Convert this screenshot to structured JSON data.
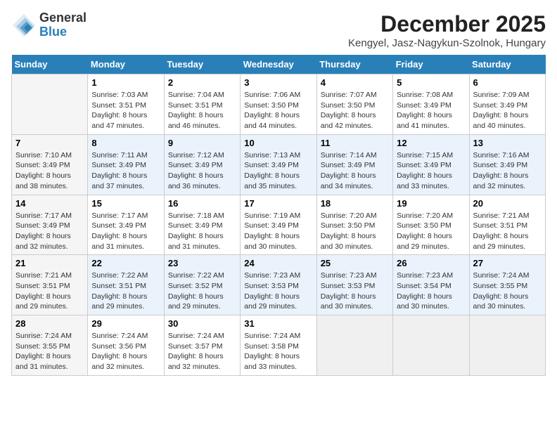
{
  "logo": {
    "general": "General",
    "blue": "Blue"
  },
  "title": "December 2025",
  "subtitle": "Kengyel, Jasz-Nagykun-Szolnok, Hungary",
  "days_header": [
    "Sunday",
    "Monday",
    "Tuesday",
    "Wednesday",
    "Thursday",
    "Friday",
    "Saturday"
  ],
  "weeks": [
    [
      {
        "day": "",
        "sunrise": "",
        "sunset": "",
        "daylight": ""
      },
      {
        "day": "1",
        "sunrise": "Sunrise: 7:03 AM",
        "sunset": "Sunset: 3:51 PM",
        "daylight": "Daylight: 8 hours and 47 minutes."
      },
      {
        "day": "2",
        "sunrise": "Sunrise: 7:04 AM",
        "sunset": "Sunset: 3:51 PM",
        "daylight": "Daylight: 8 hours and 46 minutes."
      },
      {
        "day": "3",
        "sunrise": "Sunrise: 7:06 AM",
        "sunset": "Sunset: 3:50 PM",
        "daylight": "Daylight: 8 hours and 44 minutes."
      },
      {
        "day": "4",
        "sunrise": "Sunrise: 7:07 AM",
        "sunset": "Sunset: 3:50 PM",
        "daylight": "Daylight: 8 hours and 42 minutes."
      },
      {
        "day": "5",
        "sunrise": "Sunrise: 7:08 AM",
        "sunset": "Sunset: 3:49 PM",
        "daylight": "Daylight: 8 hours and 41 minutes."
      },
      {
        "day": "6",
        "sunrise": "Sunrise: 7:09 AM",
        "sunset": "Sunset: 3:49 PM",
        "daylight": "Daylight: 8 hours and 40 minutes."
      }
    ],
    [
      {
        "day": "7",
        "sunrise": "Sunrise: 7:10 AM",
        "sunset": "Sunset: 3:49 PM",
        "daylight": "Daylight: 8 hours and 38 minutes."
      },
      {
        "day": "8",
        "sunrise": "Sunrise: 7:11 AM",
        "sunset": "Sunset: 3:49 PM",
        "daylight": "Daylight: 8 hours and 37 minutes."
      },
      {
        "day": "9",
        "sunrise": "Sunrise: 7:12 AM",
        "sunset": "Sunset: 3:49 PM",
        "daylight": "Daylight: 8 hours and 36 minutes."
      },
      {
        "day": "10",
        "sunrise": "Sunrise: 7:13 AM",
        "sunset": "Sunset: 3:49 PM",
        "daylight": "Daylight: 8 hours and 35 minutes."
      },
      {
        "day": "11",
        "sunrise": "Sunrise: 7:14 AM",
        "sunset": "Sunset: 3:49 PM",
        "daylight": "Daylight: 8 hours and 34 minutes."
      },
      {
        "day": "12",
        "sunrise": "Sunrise: 7:15 AM",
        "sunset": "Sunset: 3:49 PM",
        "daylight": "Daylight: 8 hours and 33 minutes."
      },
      {
        "day": "13",
        "sunrise": "Sunrise: 7:16 AM",
        "sunset": "Sunset: 3:49 PM",
        "daylight": "Daylight: 8 hours and 32 minutes."
      }
    ],
    [
      {
        "day": "14",
        "sunrise": "Sunrise: 7:17 AM",
        "sunset": "Sunset: 3:49 PM",
        "daylight": "Daylight: 8 hours and 32 minutes."
      },
      {
        "day": "15",
        "sunrise": "Sunrise: 7:17 AM",
        "sunset": "Sunset: 3:49 PM",
        "daylight": "Daylight: 8 hours and 31 minutes."
      },
      {
        "day": "16",
        "sunrise": "Sunrise: 7:18 AM",
        "sunset": "Sunset: 3:49 PM",
        "daylight": "Daylight: 8 hours and 31 minutes."
      },
      {
        "day": "17",
        "sunrise": "Sunrise: 7:19 AM",
        "sunset": "Sunset: 3:49 PM",
        "daylight": "Daylight: 8 hours and 30 minutes."
      },
      {
        "day": "18",
        "sunrise": "Sunrise: 7:20 AM",
        "sunset": "Sunset: 3:50 PM",
        "daylight": "Daylight: 8 hours and 30 minutes."
      },
      {
        "day": "19",
        "sunrise": "Sunrise: 7:20 AM",
        "sunset": "Sunset: 3:50 PM",
        "daylight": "Daylight: 8 hours and 29 minutes."
      },
      {
        "day": "20",
        "sunrise": "Sunrise: 7:21 AM",
        "sunset": "Sunset: 3:51 PM",
        "daylight": "Daylight: 8 hours and 29 minutes."
      }
    ],
    [
      {
        "day": "21",
        "sunrise": "Sunrise: 7:21 AM",
        "sunset": "Sunset: 3:51 PM",
        "daylight": "Daylight: 8 hours and 29 minutes."
      },
      {
        "day": "22",
        "sunrise": "Sunrise: 7:22 AM",
        "sunset": "Sunset: 3:51 PM",
        "daylight": "Daylight: 8 hours and 29 minutes."
      },
      {
        "day": "23",
        "sunrise": "Sunrise: 7:22 AM",
        "sunset": "Sunset: 3:52 PM",
        "daylight": "Daylight: 8 hours and 29 minutes."
      },
      {
        "day": "24",
        "sunrise": "Sunrise: 7:23 AM",
        "sunset": "Sunset: 3:53 PM",
        "daylight": "Daylight: 8 hours and 29 minutes."
      },
      {
        "day": "25",
        "sunrise": "Sunrise: 7:23 AM",
        "sunset": "Sunset: 3:53 PM",
        "daylight": "Daylight: 8 hours and 30 minutes."
      },
      {
        "day": "26",
        "sunrise": "Sunrise: 7:23 AM",
        "sunset": "Sunset: 3:54 PM",
        "daylight": "Daylight: 8 hours and 30 minutes."
      },
      {
        "day": "27",
        "sunrise": "Sunrise: 7:24 AM",
        "sunset": "Sunset: 3:55 PM",
        "daylight": "Daylight: 8 hours and 30 minutes."
      }
    ],
    [
      {
        "day": "28",
        "sunrise": "Sunrise: 7:24 AM",
        "sunset": "Sunset: 3:55 PM",
        "daylight": "Daylight: 8 hours and 31 minutes."
      },
      {
        "day": "29",
        "sunrise": "Sunrise: 7:24 AM",
        "sunset": "Sunset: 3:56 PM",
        "daylight": "Daylight: 8 hours and 32 minutes."
      },
      {
        "day": "30",
        "sunrise": "Sunrise: 7:24 AM",
        "sunset": "Sunset: 3:57 PM",
        "daylight": "Daylight: 8 hours and 32 minutes."
      },
      {
        "day": "31",
        "sunrise": "Sunrise: 7:24 AM",
        "sunset": "Sunset: 3:58 PM",
        "daylight": "Daylight: 8 hours and 33 minutes."
      },
      {
        "day": "",
        "sunrise": "",
        "sunset": "",
        "daylight": ""
      },
      {
        "day": "",
        "sunrise": "",
        "sunset": "",
        "daylight": ""
      },
      {
        "day": "",
        "sunrise": "",
        "sunset": "",
        "daylight": ""
      }
    ]
  ]
}
